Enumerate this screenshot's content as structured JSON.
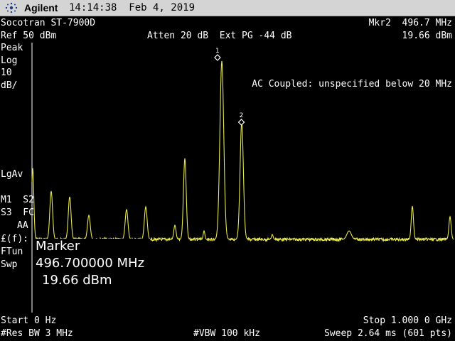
{
  "header": {
    "brand": "Agilent",
    "datetime": "14:14:38  Feb 4, 2019"
  },
  "info": {
    "device": "Socotran ST-7900D",
    "ref": "Ref 50 dBm",
    "atten": "Atten 20 dB  Ext PG -44 dB",
    "marker_freq": "Mkr2  496.7 MHz",
    "marker_amp": "19.66 dBm"
  },
  "left_panel": {
    "detector": "Peak",
    "scale_type": "Log",
    "scale_value": "10",
    "scale_unit": "dB/",
    "avg": "LgAv",
    "m1s2": "M1  S2",
    "s3fc": "S3  FC",
    "aa": "AA",
    "ff": "£(f):",
    "ftun": "FTun",
    "swp": "Swp"
  },
  "annotation": "AC Coupled: unspecified below 20 MHz",
  "marker_readout": {
    "title": "Marker",
    "freq": "496.700000 MHz",
    "amp": "19.66 dBm"
  },
  "footer": {
    "start": "Start 0 Hz",
    "stop": "Stop 1.000 0 GHz",
    "rbw": "#Res BW 3 MHz",
    "vbw": "#VBW 100 kHz",
    "sweep": "Sweep 2.64 ms (601 pts)"
  },
  "markers": [
    {
      "label": "1",
      "freq_mhz": 440
    },
    {
      "label": "2",
      "freq_mhz": 496.7
    }
  ],
  "colors": {
    "trace": "#e8e84a",
    "grid": "#ffffff",
    "text": "#ffffff",
    "background": "#000000"
  }
}
